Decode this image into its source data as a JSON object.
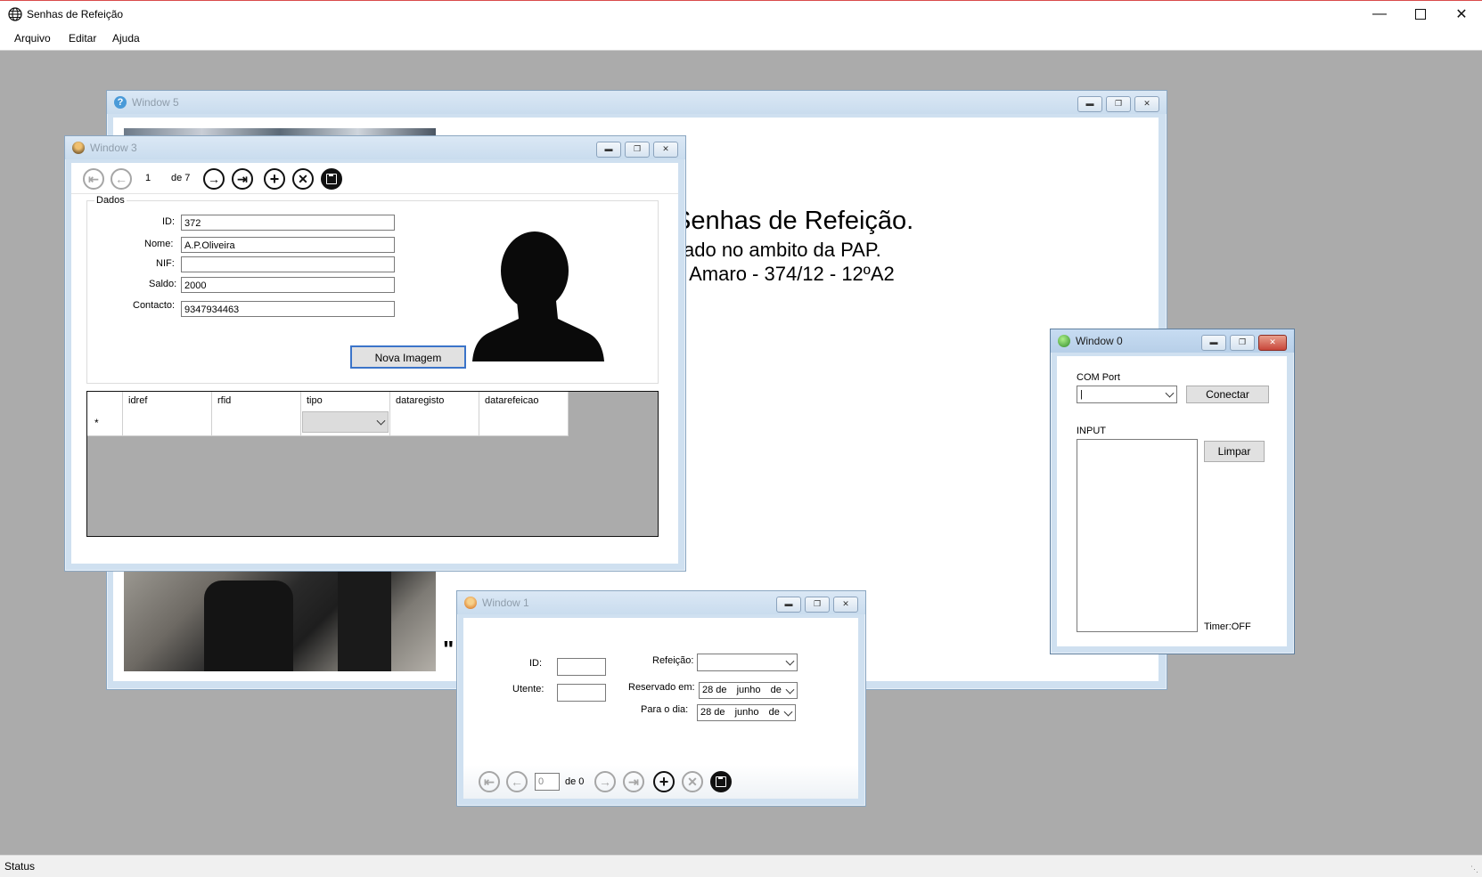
{
  "app": {
    "title": "Senhas de Refeição",
    "menu": [
      "Arquivo",
      "Editar",
      "Ajuda"
    ],
    "status": "Status"
  },
  "window5": {
    "title": "Window 5",
    "heading": "Senhas de Refeição.",
    "line2": "zado no ambito da PAP.",
    "line3": "o Amaro - 374/12 - 12ºA2",
    "quote": "\""
  },
  "window3": {
    "title": "Window 3",
    "nav": {
      "position": "1",
      "of": "de 7"
    },
    "group_label": "Dados",
    "fields": {
      "id_label": "ID:",
      "id_value": "372",
      "nome_label": "Nome:",
      "nome_value": "A.P.Oliveira",
      "nif_label": "NIF:",
      "nif_value": "",
      "saldo_label": "Saldo:",
      "saldo_value": "2000",
      "contacto_label": "Contacto:",
      "contacto_value": "9347934463"
    },
    "nova_imagem": "Nova Imagem",
    "grid": {
      "columns": [
        "idref",
        "rfid",
        "tipo",
        "dataregisto",
        "datarefeicao"
      ],
      "new_row_marker": "*"
    }
  },
  "window0": {
    "title": "Window 0",
    "com_port_label": "COM Port",
    "com_port_value": "|",
    "connect": "Conectar",
    "input_label": "INPUT",
    "clear": "Limpar",
    "timer": "Timer:OFF"
  },
  "window1": {
    "title": "Window 1",
    "id_label": "ID:",
    "utente_label": "Utente:",
    "refeicao_label": "Refeição:",
    "reservado_label": "Reservado em:",
    "reservado_value": {
      "day": "28 de",
      "month": "junho",
      "suffix": "de"
    },
    "para_label": "Para o dia:",
    "para_value": {
      "day": "28 de",
      "month": "junho",
      "suffix": "de"
    },
    "nav": {
      "position": "0",
      "of": "de 0"
    }
  }
}
